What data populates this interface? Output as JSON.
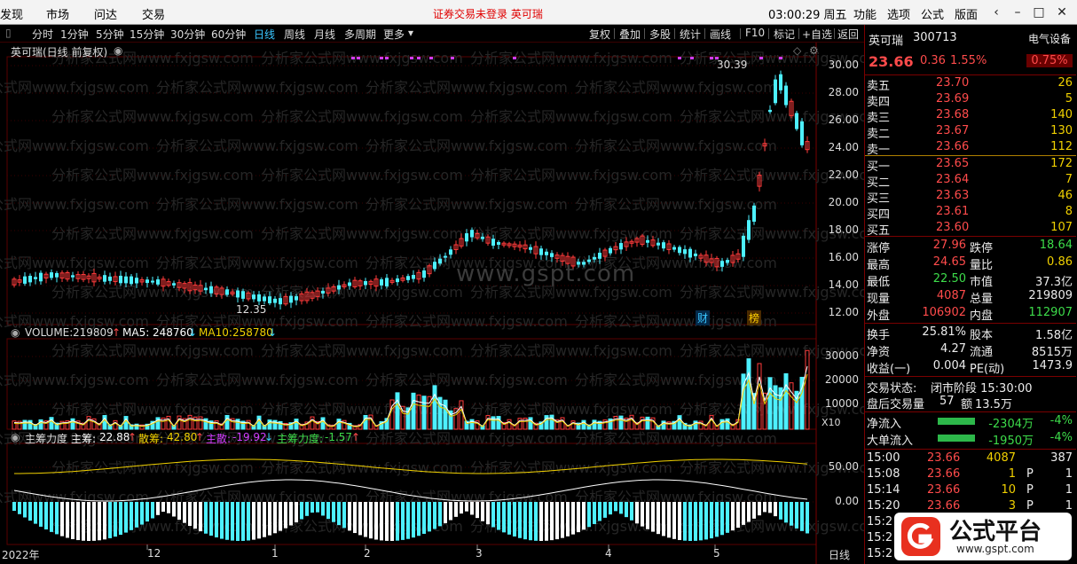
{
  "menu": {
    "items": [
      "发现",
      "市场",
      "问达",
      "交易"
    ],
    "notice": "证券交易未登录  英可瑞",
    "clock": "03:00:29 周五",
    "right_items": [
      "功能",
      "选项",
      "公式",
      "版面"
    ]
  },
  "toolbar": {
    "periods": [
      "分时",
      "1分钟",
      "5分钟",
      "15分钟",
      "30分钟",
      "60分钟",
      "日线",
      "周线",
      "月线",
      "多周期",
      "更多"
    ],
    "active": "日线",
    "tools": [
      "复权",
      "叠加",
      "多股",
      "统计",
      "画线",
      "F10",
      "标记",
      "+自选",
      "返回"
    ]
  },
  "main_panel": {
    "title": "英可瑞(日线 前复权)",
    "price_axis": [
      "30.00",
      "28.00",
      "26.00",
      "24.00",
      "22.00",
      "20.00",
      "18.00",
      "16.00",
      "14.00",
      "12.00"
    ],
    "high_label": "30.39",
    "low_label": "12.35",
    "badge_fin": "财",
    "badge_rank": "榜",
    "watermark": "www.gspt.com"
  },
  "volume_panel": {
    "name": "VOLUME:",
    "volume": "219809",
    "ma5_label": "MA5:",
    "ma5": "248760",
    "ma10_label": "MA10:",
    "ma10": "258780",
    "axis": [
      "30000",
      "20000",
      "10000"
    ],
    "unit": "X10"
  },
  "force_panel": {
    "name": "主筹力度",
    "main_label": "主筹:",
    "main": "22.88",
    "scatter_label": "散筹:",
    "scatter": "42.80",
    "sell_label": "主散:",
    "sell": "-19.92",
    "force_label": "主筹力度:",
    "force": "-1.57",
    "axis": [
      "50.00",
      "0.00"
    ]
  },
  "x_axis": {
    "labels": [
      "2022年",
      "12",
      "1",
      "2",
      "3",
      "4",
      "5"
    ],
    "period": "日线"
  },
  "watermark_text": "分析家公式网www.fxjgsw.com",
  "stock": {
    "name": "英可瑞",
    "code": "300713",
    "sector": "电气设备",
    "price": "23.66",
    "change": "0.36",
    "pct": "1.55%",
    "sector_pct": "0.75%"
  },
  "asks": [
    {
      "label": "卖五",
      "price": "23.70",
      "vol": "26"
    },
    {
      "label": "卖四",
      "price": "23.69",
      "vol": "5"
    },
    {
      "label": "卖三",
      "price": "23.68",
      "vol": "140"
    },
    {
      "label": "卖二",
      "price": "23.67",
      "vol": "130"
    },
    {
      "label": "卖一",
      "price": "23.66",
      "vol": "112"
    }
  ],
  "bids": [
    {
      "label": "买一",
      "price": "23.65",
      "vol": "172"
    },
    {
      "label": "买二",
      "price": "23.64",
      "vol": "7"
    },
    {
      "label": "买三",
      "price": "23.63",
      "vol": "46"
    },
    {
      "label": "买四",
      "price": "23.61",
      "vol": "8"
    },
    {
      "label": "买五",
      "price": "23.60",
      "vol": "107"
    }
  ],
  "quote": [
    {
      "l1": "涨停",
      "v1": "27.96",
      "l2": "跌停",
      "v2": "18.64"
    },
    {
      "l1": "最高",
      "v1": "24.65",
      "l2": "量比",
      "v2": "0.86"
    },
    {
      "l1": "最低",
      "v1": "22.50",
      "l2": "市值",
      "v2": "37.3亿"
    },
    {
      "l1": "现量",
      "v1": "4087",
      "l2": "总量",
      "v2": "219809"
    },
    {
      "l1": "外盘",
      "v1": "106902",
      "l2": "内盘",
      "v2": "112907"
    }
  ],
  "finance": [
    {
      "l1": "换手",
      "v1": "25.81%",
      "l2": "股本",
      "v2": "1.58亿"
    },
    {
      "l1": "净资",
      "v1": "4.27",
      "l2": "流通",
      "v2": "8515万"
    },
    {
      "l1": "收益(一)",
      "v1": "0.004",
      "l2": "PE(动)",
      "v2": "1473.9"
    }
  ],
  "status": {
    "trade_label": "交易状态:",
    "trade_value": "闭市阶段 15:30:00",
    "after_label": "盘后交易量",
    "after_vol": "57",
    "after_amt_label": "额",
    "after_amt": "13.5万"
  },
  "flows": [
    {
      "label": "净流入",
      "value": "-2304万",
      "pct": "-4%"
    },
    {
      "label": "大单流入",
      "value": "-1950万",
      "pct": "-4%"
    }
  ],
  "ticks": [
    {
      "time": "15:00",
      "price": "23.66",
      "vol": "4087",
      "dir": "",
      "n": "387"
    },
    {
      "time": "15:08",
      "price": "23.66",
      "vol": "1",
      "dir": "P",
      "n": "1"
    },
    {
      "time": "15:14",
      "price": "23.66",
      "vol": "10",
      "dir": "P",
      "n": "1"
    },
    {
      "time": "15:20",
      "price": "23.66",
      "vol": "3",
      "dir": "P",
      "n": "1"
    },
    {
      "time": "15:2",
      "price": "",
      "vol": "",
      "dir": "",
      "n": ""
    },
    {
      "time": "15:2",
      "price": "",
      "vol": "",
      "dir": "",
      "n": ""
    },
    {
      "time": "15:2",
      "price": "",
      "vol": "",
      "dir": "",
      "n": ""
    }
  ],
  "logo": {
    "title": "公式平台",
    "url": "www.gspt.com"
  },
  "colors": {
    "up": "#ff3b3b",
    "down": "#4df0ff",
    "ma5": "#ffffff",
    "ma10": "#f0d000",
    "grid": "#3a0000"
  }
}
